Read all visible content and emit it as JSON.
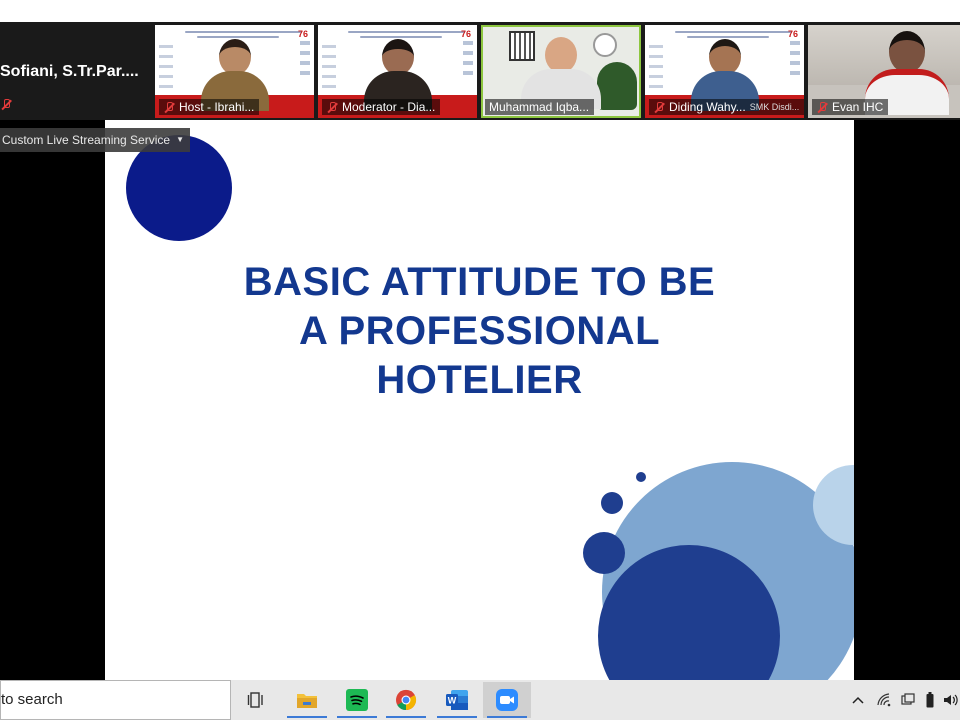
{
  "gallery": {
    "speaker_left": {
      "name": "Sofiani,  S.Tr.Par...."
    },
    "tiles": [
      {
        "label": "Host - Ibrahi..."
      },
      {
        "label": "Moderator - Dia..."
      },
      {
        "label": "Muhammad Iqba..."
      },
      {
        "label": "Diding Wahy...",
        "sublabel": "SMK Disdi..."
      },
      {
        "label": "Evan IHC"
      }
    ],
    "webinar_banner": "BAKTIKU untuk INDONESIAKU",
    "banner_number": "76"
  },
  "stream_menu": {
    "label": "Custom Live Streaming Service"
  },
  "slide": {
    "title_lines": [
      "BASIC ATTITUDE TO BE",
      "A PROFESSIONAL",
      "HOTELIER"
    ],
    "colors": {
      "title": "#13388f",
      "navy": "#0b1b8a",
      "steel": "#7ea6d0",
      "light": "#b9d3ea"
    }
  },
  "taskbar": {
    "search_placeholder": "to search",
    "apps": [
      "task-view-icon",
      "file-explorer-icon",
      "spotify-icon",
      "chrome-icon",
      "word-icon",
      "zoom-icon"
    ],
    "word_glyph": "W"
  }
}
